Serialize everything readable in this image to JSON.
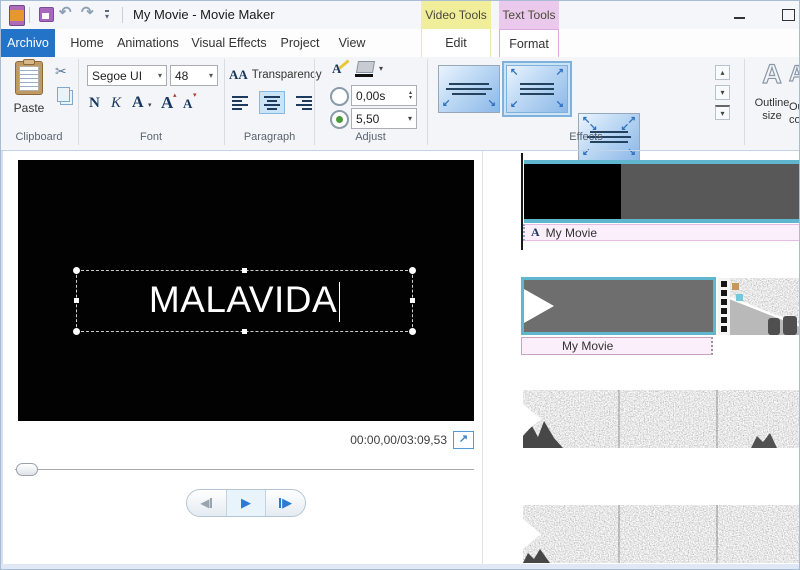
{
  "window": {
    "title": "My Movie - Movie Maker",
    "video_tools_label": "Video Tools",
    "text_tools_label": "Text Tools"
  },
  "tabs": [
    "Archivo",
    "Home",
    "Animations",
    "Visual Effects",
    "Project",
    "View",
    "Edit",
    "Format"
  ],
  "ribbon": {
    "clipboard": {
      "paste_label": "Paste",
      "group_label": "Clipboard"
    },
    "font": {
      "family": "Segoe UI",
      "size": "48",
      "bold_label": "N",
      "italic_label": "K",
      "color_label": "A",
      "grow_label": "A",
      "shrink_label": "A",
      "group_label": "Font"
    },
    "paragraph": {
      "icon_letters": "AA",
      "transparency_label": "Transparency",
      "group_label": "Paragraph"
    },
    "adjust": {
      "time_value": "0,00s",
      "duration_value": "5,50",
      "group_label": "Adjust"
    },
    "effects": {
      "group_label": "Effects"
    },
    "outline": {
      "letter": "A",
      "line1": "Outline",
      "line2": "size",
      "partial1": "Ou",
      "partial2": "co"
    }
  },
  "preview": {
    "title_text": "MALAVIDA",
    "timecode": "00:00,00/03:09,53"
  },
  "timeline": {
    "caption1_icon": "A",
    "caption1": "My Movie",
    "caption2": "My Movie"
  },
  "icons": {
    "undo": "↶",
    "redo": "↷",
    "qat_dropdown": "▾",
    "cut": "✂",
    "dropdown": "▾",
    "spin_up": "▴",
    "spin_down": "▾",
    "scroll_up": "▴",
    "scroll_down": "▾",
    "scroll_more": "▾",
    "fullscreen": "↗",
    "prev": "◀",
    "play": "▶",
    "next": "▶",
    "minimize": "bar",
    "maximize": "box",
    "arrow_dl": "↙",
    "arrow_dr": "↘",
    "arrow_ul": "↖",
    "arrow_ur": "↗"
  },
  "colors": {
    "accent_blue": "#2373c8",
    "video_tools_bg": "#f0ed9b",
    "text_tools_bg": "#eac9ec",
    "selection_cyan": "#5fb6ce",
    "caption_pink": "#fbeffb",
    "effect_selected": "#cde4f6"
  }
}
